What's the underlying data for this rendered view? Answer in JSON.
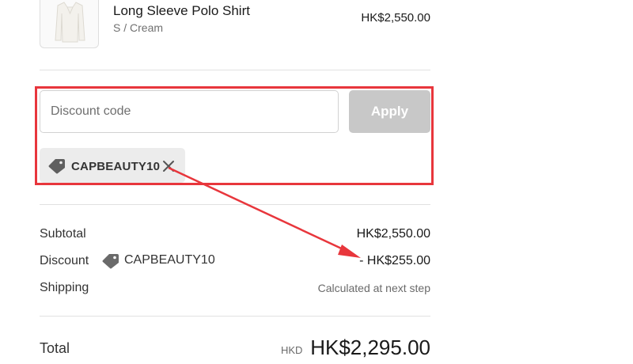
{
  "product": {
    "name": "Long Sleeve Polo Shirt",
    "variant": "S / Cream",
    "price": "HK$2,550.00",
    "image_icon": "product-thumbnail"
  },
  "discount_form": {
    "placeholder": "Discount code",
    "value": "",
    "apply_label": "Apply",
    "applied_code": "CAPBEAUTY10",
    "tag_icon": "tag-icon",
    "remove_icon": "close-icon"
  },
  "summary": {
    "subtotal_label": "Subtotal",
    "subtotal_value": "HK$2,550.00",
    "discount_label": "Discount",
    "discount_code": "CAPBEAUTY10",
    "discount_value": "- HK$255.00",
    "shipping_label": "Shipping",
    "shipping_value": "Calculated at next step",
    "total_label": "Total",
    "total_currency": "HKD",
    "total_value": "HK$2,295.00"
  },
  "colors": {
    "annotation_red": "#e8363c",
    "apply_button_disabled": "#c8c8c8",
    "chip_background": "#ececec"
  }
}
